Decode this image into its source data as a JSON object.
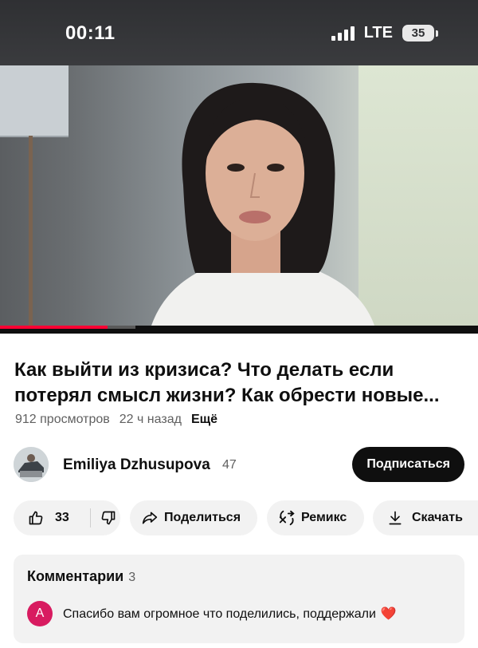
{
  "status_bar": {
    "time": "00:11",
    "network": "LTE",
    "battery": "35"
  },
  "video": {
    "progress_fraction": 0.225,
    "title": "Как выйти из кризиса? Что делать если потерял смысл жизни? Как обрести новые...",
    "views": "912 просмотров",
    "age": "22 ч назад",
    "more_label": "Ещё"
  },
  "channel": {
    "name": "Emiliya Dzhusupova",
    "subscribers": "47",
    "subscribe_label": "Подписаться"
  },
  "actions": {
    "likes": "33",
    "share_label": "Поделиться",
    "remix_label": "Ремикс",
    "download_label": "Скачать"
  },
  "comments": {
    "heading": "Комментарии",
    "count": "3",
    "top": {
      "author_initial": "A",
      "text": "Спасибо вам огромное что поделились, поддержали",
      "emoji": "❤️"
    }
  },
  "colors": {
    "accent": "#ff0033",
    "subscribe_bg": "#0f0f0f",
    "pill_bg": "#f2f2f2",
    "comment_avatar": "#d81b60"
  },
  "icons": [
    "like-icon",
    "dislike-icon",
    "share-icon",
    "remix-icon",
    "download-icon"
  ]
}
